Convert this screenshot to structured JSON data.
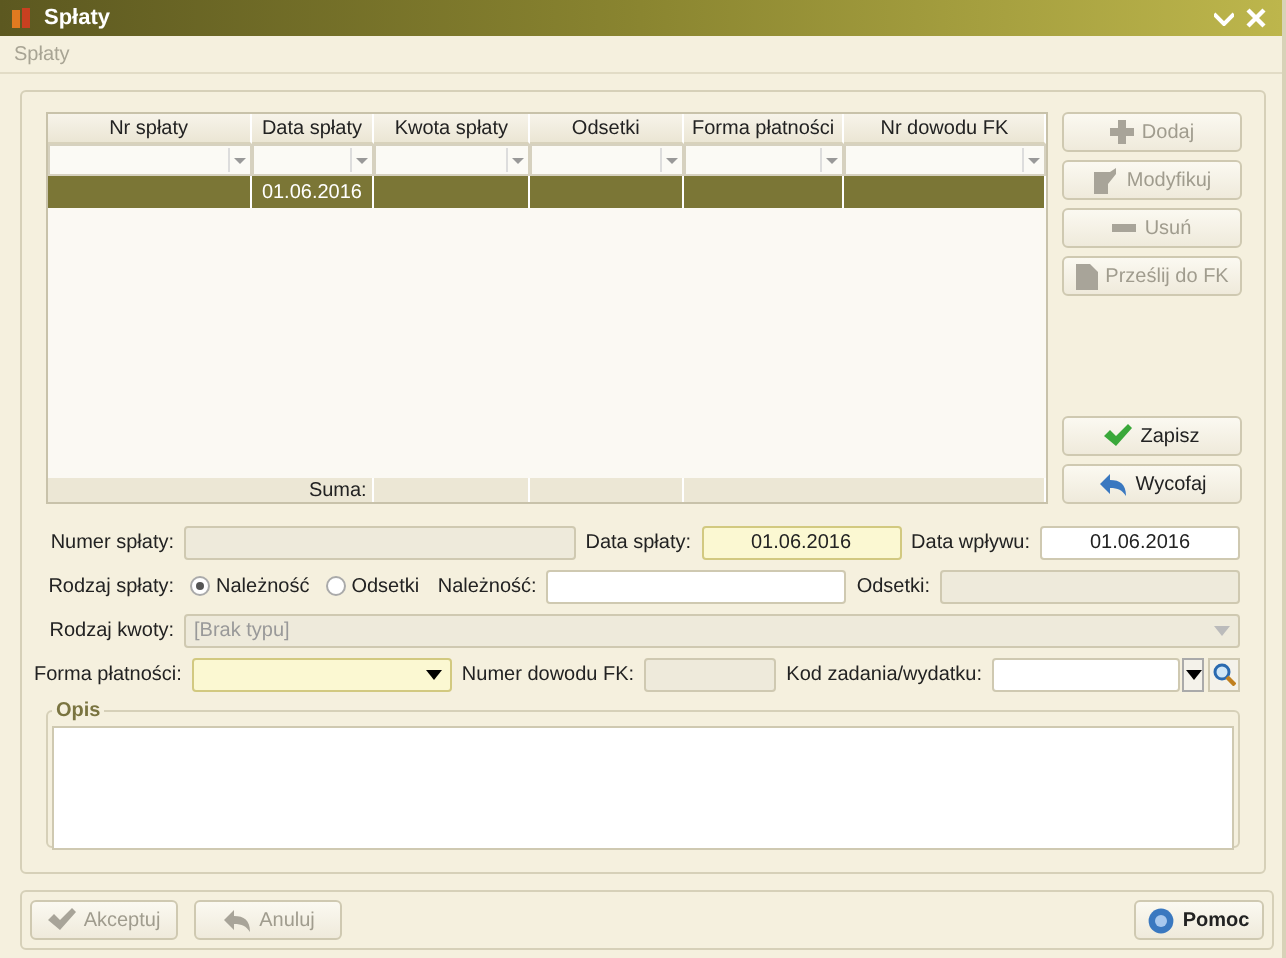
{
  "window": {
    "title": "Spłaty"
  },
  "menu": [
    {
      "label": "Spłaty",
      "disabled": true
    }
  ],
  "table": {
    "columns": [
      {
        "label": "Nr spłaty"
      },
      {
        "label": "Data spłaty"
      },
      {
        "label": "Kwota spłaty"
      },
      {
        "label": "Odsetki"
      },
      {
        "label": "Forma płatności"
      },
      {
        "label": "Nr dowodu FK"
      }
    ],
    "rows": [
      {
        "selected": true,
        "cells": [
          null,
          "01.06.2016",
          null,
          null,
          null,
          null
        ]
      }
    ],
    "sum_label": "Suma:"
  },
  "side_buttons": [
    {
      "label": "Dodaj",
      "disabled": true
    },
    {
      "label": "Modyfikuj",
      "disabled": true
    },
    {
      "label": "Usuń",
      "disabled": true
    },
    {
      "label": "Prześlij do FK",
      "disabled": true
    }
  ],
  "save_buttons": [
    {
      "label": "Zapisz",
      "disabled": false
    },
    {
      "label": "Wycofaj",
      "disabled": false
    }
  ],
  "form": {
    "numer_splaty": {
      "label": "Numer spłaty:",
      "disabled": true
    },
    "data_splaty": {
      "label": "Data spłaty:",
      "value": "01.06.2016",
      "required": true
    },
    "data_wplywu": {
      "label": "Data wpływu:",
      "value": "01.06.2016",
      "required": false
    },
    "rodzaj_splaty": {
      "label": "Rodzaj spłaty:",
      "options": [
        {
          "label": "Należność",
          "selected": true
        },
        {
          "label": "Odsetki",
          "selected": false
        }
      ]
    },
    "naleznosc": {
      "label": "Należność:",
      "disabled": false
    },
    "odsetki": {
      "label": "Odsetki:",
      "disabled": true
    },
    "rodzaj_kwoty": {
      "label": "Rodzaj kwoty:",
      "value": "[Brak typu]",
      "disabled": true
    },
    "forma_platnosci": {
      "label": "Forma płatności:",
      "required": true
    },
    "numer_dowodu_fk": {
      "label": "Numer dowodu FK:",
      "disabled": true
    },
    "kod_zadania": {
      "label": "Kod zadania/wydatku:",
      "disabled": false
    },
    "opis": {
      "label": "Opis"
    }
  },
  "bottom_buttons": [
    {
      "label": "Akceptuj",
      "disabled": true
    },
    {
      "label": "Anuluj",
      "disabled": true
    }
  ],
  "help_button": {
    "label": "Pomoc",
    "disabled": false
  }
}
